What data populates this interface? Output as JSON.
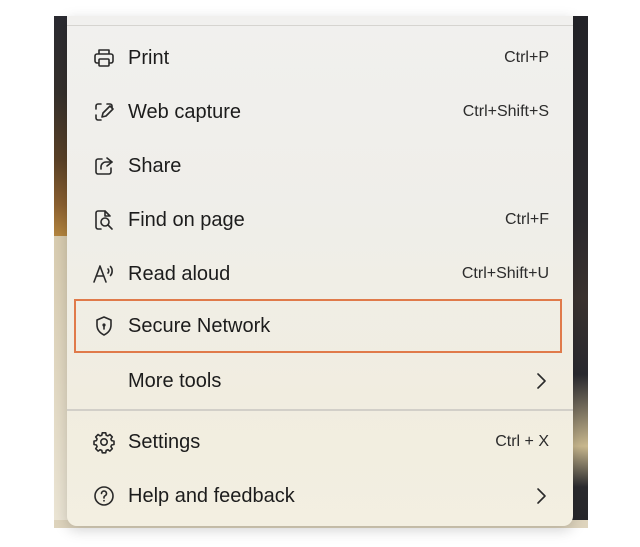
{
  "menu": {
    "items": [
      {
        "label": "Print",
        "shortcut": "Ctrl+P",
        "icon": "printer-icon"
      },
      {
        "label": "Web capture",
        "shortcut": "Ctrl+Shift+S",
        "icon": "web-capture-icon"
      },
      {
        "label": "Share",
        "shortcut": "",
        "icon": "share-icon"
      },
      {
        "label": "Find on page",
        "shortcut": "Ctrl+F",
        "icon": "find-on-page-icon"
      },
      {
        "label": "Read aloud",
        "shortcut": "Ctrl+Shift+U",
        "icon": "read-aloud-icon"
      },
      {
        "label": "Secure Network",
        "shortcut": "",
        "icon": "shield-icon",
        "highlight_color": "#e07a4a"
      },
      {
        "label": "More tools",
        "shortcut": "",
        "icon": "chevron-right-icon"
      },
      {
        "label": "Settings",
        "shortcut": "Ctrl + X",
        "icon": "gear-icon"
      },
      {
        "label": "Help and feedback",
        "shortcut": "",
        "icon": "help-icon"
      }
    ]
  }
}
